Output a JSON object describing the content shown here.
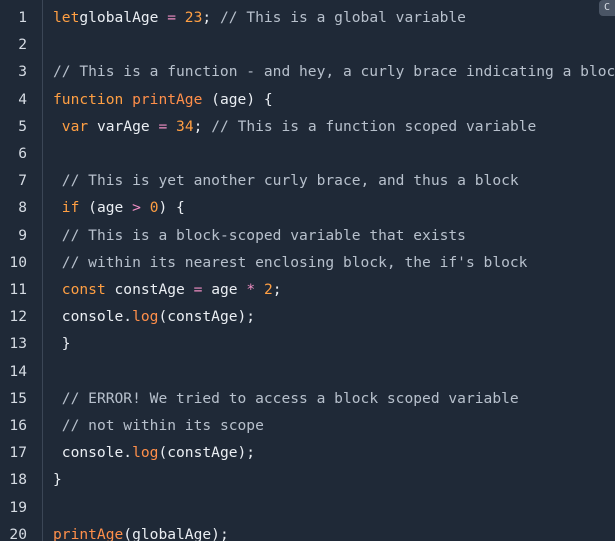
{
  "editor": {
    "copy_label": "C",
    "lines": [
      {
        "no": "1",
        "segments": [
          [
            "kw",
            "let"
          ],
          [
            "",
            "globalAge"
          ],
          [
            "op",
            " = "
          ],
          [
            "num",
            "23"
          ],
          [
            "",
            ";"
          ],
          [
            "cm",
            " // This is a global variable"
          ]
        ]
      },
      {
        "no": "2",
        "segments": []
      },
      {
        "no": "3",
        "segments": [
          [
            "cm",
            "// This is a function - and hey, a curly brace indicating a block"
          ]
        ]
      },
      {
        "no": "4",
        "segments": [
          [
            "kw",
            "function"
          ],
          [
            "",
            " "
          ],
          [
            "fn",
            "printAge"
          ],
          [
            "",
            " (age) {"
          ]
        ]
      },
      {
        "no": "5",
        "segments": [
          [
            "",
            " "
          ],
          [
            "kw",
            "var"
          ],
          [
            "",
            " varAge "
          ],
          [
            "op",
            "="
          ],
          [
            "",
            " "
          ],
          [
            "num",
            "34"
          ],
          [
            "",
            ";"
          ],
          [
            "cm",
            " // This is a function scoped variable"
          ]
        ]
      },
      {
        "no": "6",
        "segments": []
      },
      {
        "no": "7",
        "segments": [
          [
            "",
            " "
          ],
          [
            "cm",
            "// This is yet another curly brace, and thus a block"
          ]
        ]
      },
      {
        "no": "8",
        "segments": [
          [
            "",
            " "
          ],
          [
            "kw",
            "if"
          ],
          [
            "",
            " (age "
          ],
          [
            "op",
            ">"
          ],
          [
            "",
            " "
          ],
          [
            "num",
            "0"
          ],
          [
            "",
            ") {"
          ]
        ]
      },
      {
        "no": "9",
        "segments": [
          [
            "",
            " "
          ],
          [
            "cm",
            "// This is a block-scoped variable that exists"
          ]
        ]
      },
      {
        "no": "10",
        "segments": [
          [
            "",
            " "
          ],
          [
            "cm",
            "// within its nearest enclosing block, the if's block"
          ]
        ]
      },
      {
        "no": "11",
        "segments": [
          [
            "",
            " "
          ],
          [
            "kw",
            "const"
          ],
          [
            "",
            " constAge "
          ],
          [
            "op",
            "="
          ],
          [
            "",
            " age "
          ],
          [
            "op",
            "*"
          ],
          [
            "",
            " "
          ],
          [
            "num",
            "2"
          ],
          [
            "",
            ";"
          ]
        ]
      },
      {
        "no": "12",
        "segments": [
          [
            "",
            " console."
          ],
          [
            "fn",
            "log"
          ],
          [
            "",
            "(constAge);"
          ]
        ]
      },
      {
        "no": "13",
        "segments": [
          [
            "",
            " }"
          ]
        ]
      },
      {
        "no": "14",
        "segments": []
      },
      {
        "no": "15",
        "segments": [
          [
            "",
            " "
          ],
          [
            "cm",
            "// ERROR! We tried to access a block scoped variable"
          ]
        ]
      },
      {
        "no": "16",
        "segments": [
          [
            "",
            " "
          ],
          [
            "cm",
            "// not within its scope"
          ]
        ]
      },
      {
        "no": "17",
        "segments": [
          [
            "",
            " console."
          ],
          [
            "fn",
            "log"
          ],
          [
            "",
            "(constAge);"
          ]
        ]
      },
      {
        "no": "18",
        "segments": [
          [
            "",
            "}"
          ]
        ]
      },
      {
        "no": "19",
        "segments": []
      },
      {
        "no": "20",
        "segments": [
          [
            "fn",
            "printAge"
          ],
          [
            "",
            "(globalAge);"
          ]
        ]
      }
    ]
  }
}
